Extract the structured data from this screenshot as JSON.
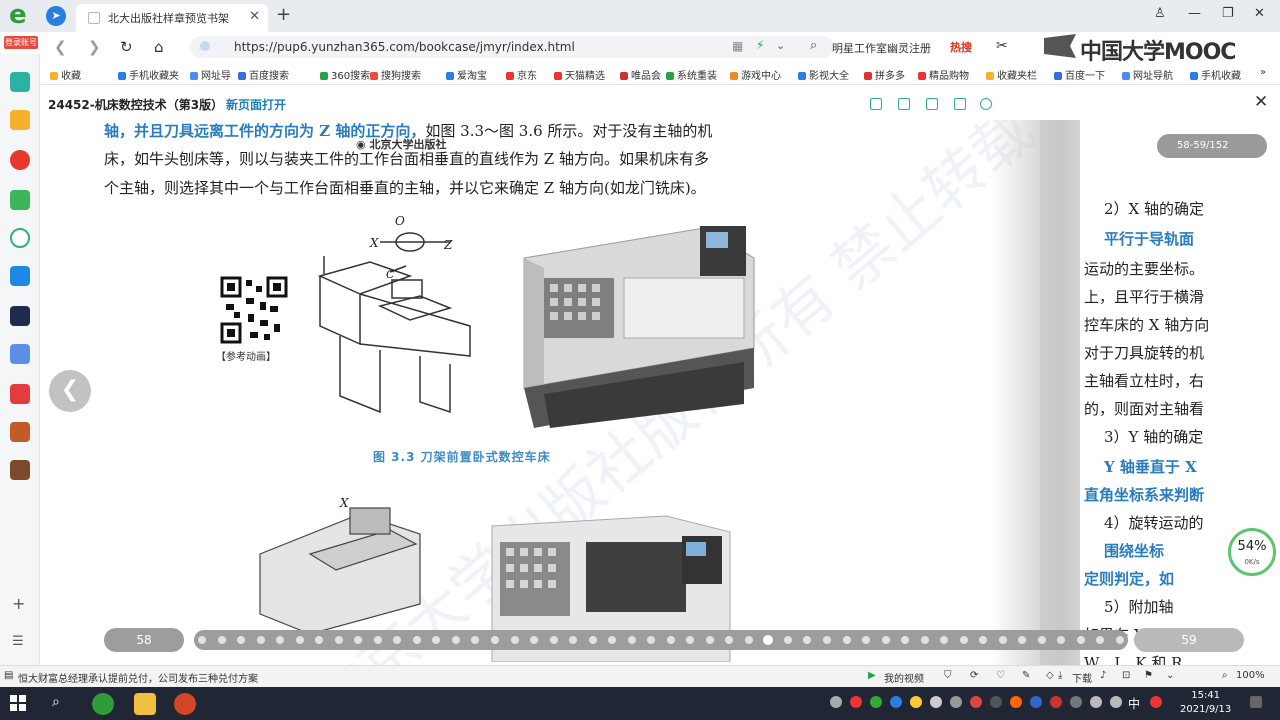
{
  "browser": {
    "profile_badge": "登录账号",
    "tab_title": "北大出版社样章预览书架",
    "url": "https://pup6.yunzhan365.com/bookcase/jmyr/index.html",
    "search_text": "明星工作室幽灵注册",
    "search_hot": "热搜",
    "mooc_logo": "中国大学MOOC",
    "bookmarks": [
      "收藏",
      "手机收藏夹",
      "网址导",
      "百度搜索",
      "360搜索",
      "搜狗搜索",
      "爱淘宝",
      "京东",
      "天猫精选",
      "唯品会",
      "系统重装",
      "游戏中心",
      "影视大全",
      "拼多多",
      "精品购物",
      "收藏夹栏",
      "百度一下",
      "网址导航",
      "手机收藏"
    ]
  },
  "book": {
    "title": "24452-机床数控技术（第3版）",
    "new_page": "新页面打开",
    "page_counter": "58-59/152",
    "page_left_num": "58",
    "page_right_num": "59",
    "left_text": {
      "line1_blue": "轴，并且刀具远离工件的方向为 Z 轴的正方向，",
      "line1_rest": "如图 3.3～图 3.6 所示。对于没有主轴的机",
      "line2": "床，如牛头刨床等，则以与装夹工件的工作台面相垂直的直线作为 Z 轴方向。如果机床有多",
      "line3": "个主轴，则选择其中一个与工作台面相垂直的主轴，并以它来确定 Z 轴方向(如龙门铣床)。"
    },
    "publisher_logo": "北京大学出版社",
    "qr_label": "【参考动画】",
    "diagram_labels": {
      "o": "O",
      "x": "X",
      "z": "Z",
      "c": "C",
      "x2": "X"
    },
    "caption": "图 3.3   刀架前置卧式数控车床",
    "watermark": "北京大学出版社版权所有 禁止转载",
    "right_text": [
      {
        "text": "2）X 轴的确定",
        "style": "normal"
      },
      {
        "text": "平行于导轨面",
        "style": "blue"
      },
      {
        "text": "运动的主要坐标。",
        "style": "normal"
      },
      {
        "text": "上，且平行于横滑",
        "style": "normal"
      },
      {
        "text": "控车床的 X 轴方向",
        "style": "normal"
      },
      {
        "text": "对于刀具旋转的机",
        "style": "normal"
      },
      {
        "text": "主轴看立柱时，右",
        "style": "normal"
      },
      {
        "text": "的，则面对主轴看",
        "style": "normal"
      },
      {
        "text": "3）Y 轴的确定",
        "style": "normal"
      },
      {
        "text": "Y 轴垂直于 X",
        "style": "blue"
      },
      {
        "text": "直角坐标系来判断",
        "style": "blue"
      },
      {
        "text": "4）旋转运动的",
        "style": "normal"
      },
      {
        "text": "围绕坐标",
        "style": "blue"
      },
      {
        "text": "定则判定，如",
        "style": "blue"
      },
      {
        "text": "5）附加轴",
        "style": "normal"
      },
      {
        "text": "如果在 X、Y",
        "style": "normal"
      },
      {
        "text": "W、I、K 和 R",
        "style": "normal"
      }
    ],
    "scrubber_dots": 48,
    "scrubber_current_index": 29
  },
  "net_widget": {
    "percent": "54%",
    "speed": "0K/s"
  },
  "statusbar": {
    "news": "恒大财富总经理承认提前兑付，公司发布三种兑付方案",
    "my_video": "我的视频",
    "download": "下载",
    "zoom": "100%"
  },
  "taskbar": {
    "time": "15:41",
    "date": "2021/9/13",
    "ime": "中"
  },
  "colors": {
    "accent_blue": "#2a7cc0",
    "teal": "#2fae9b",
    "taskbar": "#202633"
  }
}
